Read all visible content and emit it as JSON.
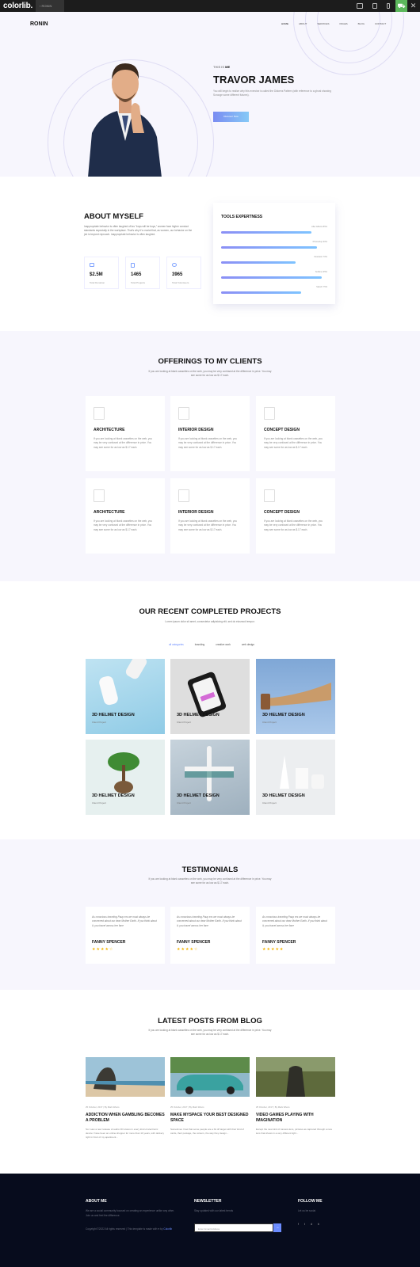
{
  "topbar": {
    "brand": "colorlib.",
    "tab": "RONIN",
    "close": "✕"
  },
  "site": {
    "logo": "RONIN",
    "nav": [
      "HOME",
      "ABOUT",
      "SERVICES",
      "PAGES",
      "BLOG",
      "CONTACT"
    ]
  },
  "hero": {
    "hello": "THIS IS",
    "hello_bold": "ME",
    "name": "TRAVOR JAMES",
    "desc": "You will begin to realize why this exercise is called the Dickens Pattern (with reference to a ghost showing Scrooge some different futures).",
    "button": "Discover Now"
  },
  "about": {
    "title": "ABOUT MYSELF",
    "desc": "Inappropriate behavior is often laughed off as \"boys will be boys,\" women face higher conduct standards especially in the workplace. That's why it's crucial that, as women, our behavior on the job is beyond reproach. inappropriate behavior is often laughed.",
    "stats": [
      {
        "value": "$2.5M",
        "label": "Total Donation"
      },
      {
        "value": "1465",
        "label": "Total Projects"
      },
      {
        "value": "3965",
        "label": "Total Volunteers"
      }
    ]
  },
  "tools": {
    "title": "TOOLS EXPERTNESS",
    "skills": [
      {
        "label": "After Effects 85%",
        "value": 85
      },
      {
        "label": "Photoshop 90%",
        "value": 90
      },
      {
        "label": "Illustrator 70%",
        "value": 70
      },
      {
        "label": "Sublime 95%",
        "value": 95
      },
      {
        "label": "Sketch 75%",
        "value": 75
      }
    ]
  },
  "offerings": {
    "title": "OFFERINGS TO MY CLIENTS",
    "desc": "If you are looking at blank cassettes on the web, you may be very confused at the difference in price. You may see some for as low as $.17 each.",
    "cards": [
      {
        "title": "ARCHITECTURE",
        "desc": "If you are looking at blank cassettes on the web, you may be very confused at the difference in price. You may see some for as low as $.17 each."
      },
      {
        "title": "INTERIOR DESIGN",
        "desc": "If you are looking at blank cassettes on the web, you may be very confused at the difference in price. You may see some for as low as $.17 each."
      },
      {
        "title": "CONCEPT DESIGN",
        "desc": "If you are looking at blank cassettes on the web, you may be very confused at the difference in price. You may see some for as low as $.17 each."
      },
      {
        "title": "ARCHITECTURE",
        "desc": "If you are looking at blank cassettes on the web, you may be very confused at the difference in price. You may see some for as low as $.17 each."
      },
      {
        "title": "INTERIOR DESIGN",
        "desc": "If you are looking at blank cassettes on the web, you may be very confused at the difference in price. You may see some for as low as $.17 each."
      },
      {
        "title": "CONCEPT DESIGN",
        "desc": "If you are looking at blank cassettes on the web, you may be very confused at the difference in price. You may see some for as low as $.17 each."
      }
    ]
  },
  "projects": {
    "title": "OUR RECENT COMPLETED PROJECTS",
    "desc": "Lorem ipsum dolor sit amet, consectetur adipisicing elit, sed do eiusmod tempor.",
    "filters": [
      "all categories",
      "branding",
      "creative work",
      "web design"
    ],
    "items": [
      {
        "title": "3D HELMET DESIGN",
        "sub": "Client Project"
      },
      {
        "title": "3D HELMET DESIGN",
        "sub": "Client Project"
      },
      {
        "title": "3D HELMET DESIGN",
        "sub": "Client Project"
      },
      {
        "title": "3D HELMET DESIGN",
        "sub": "Client Project"
      },
      {
        "title": "3D HELMET DESIGN",
        "sub": "Client Project"
      },
      {
        "title": "3D HELMET DESIGN",
        "sub": "Client Project"
      }
    ]
  },
  "testimonials": {
    "title": "TESTIMONIALS",
    "desc": "If you are looking at blank cassettes on the web, you may be very confused at the difference in price. You may see some for as low as $.17 each.",
    "items": [
      {
        "quote": "As conscious traveling Paup ers we must always be concerned about our dear Mother Earth. If you think about it, you travel across her face",
        "name": "FANNY SPENCER",
        "stars": "★★★★☆"
      },
      {
        "quote": "As conscious traveling Paup ers we must always be concerned about our dear Mother Earth. If you think about it, you travel across her face",
        "name": "FANNY SPENCER",
        "stars": "★★★★☆"
      },
      {
        "quote": "As conscious traveling Paup ers we must always be concerned about our dear Mother Earth. If you think about it, you travel across her face",
        "name": "FANNY SPENCER",
        "stars": "★★★★★"
      }
    ]
  },
  "blog": {
    "title": "LATEST POSTS FROM BLOG",
    "desc": "If you are looking at blank cassettes on the web, you may be very confused at the difference in price. You may see some for as low as $.17 each.",
    "posts": [
      {
        "meta": "25 October, 2017 | By Mark Wiens",
        "title": "ADDICTION WHEN GAMBLING BECOMES A PROBLEM",
        "desc": "So I saw a new release of audio CD stores in every kind of electronic device I have been an online shopper for more than 10 years, with delivery right in front of my apartment..."
      },
      {
        "meta": "25 October, 2017 | By Mark Wiens",
        "title": "MAKE MYSPACE YOUR BEST DESIGNED SPACE",
        "desc": "Sometimes I feel that some people are a bit off target with their kind of cards, their postage, the colours, the way they design..."
      },
      {
        "meta": "25 October, 2017 | By Mark Wiens",
        "title": "VIDEO GAMES PLAYING WITH IMAGINATION",
        "desc": "Except the new kind of camera lens, pictures as captured through a new lens that shows in a very different light..."
      }
    ]
  },
  "footer": {
    "about_title": "ABOUT ME",
    "about_desc": "We are a social community focused on creating an experience unlike any other. Join us and feel the difference.",
    "copyright": "Copyright ©2022 All rights reserved | This template is made with ♥ by",
    "copyright_link": "Colorlib",
    "newsletter_title": "NEWSLETTER",
    "newsletter_desc": "Stay updated with our latest trends",
    "email_placeholder": "Enter Email Address",
    "newsletter_btn": "→",
    "follow_title": "FOLLOW ME",
    "follow_desc": "Let us be social",
    "social": [
      "f",
      "t",
      "d",
      "b"
    ]
  }
}
